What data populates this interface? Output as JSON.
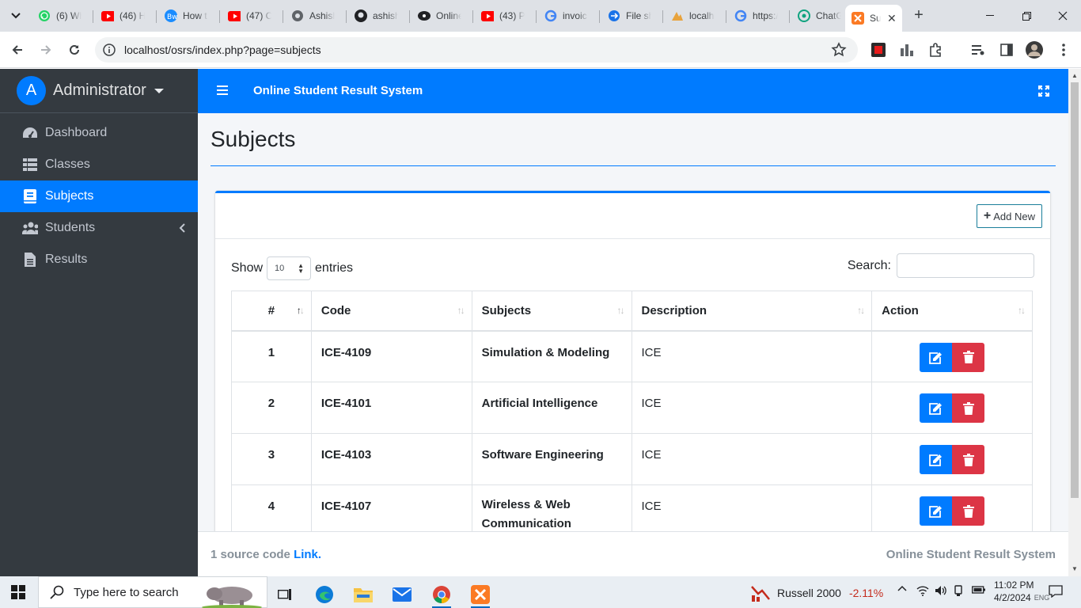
{
  "browser": {
    "tabs": [
      {
        "title": "(6) Wh",
        "icon": "whatsapp-icon"
      },
      {
        "title": "(46) H",
        "icon": "youtube-icon"
      },
      {
        "title": "How t",
        "icon": "blog-icon"
      },
      {
        "title": "(47) C",
        "icon": "youtube-icon"
      },
      {
        "title": "Ashish",
        "icon": "globe-icon"
      },
      {
        "title": "ashish",
        "icon": "github-icon"
      },
      {
        "title": "Online",
        "icon": "eye-icon"
      },
      {
        "title": "(43) P",
        "icon": "youtube-icon"
      },
      {
        "title": "invoic",
        "icon": "google-icon"
      },
      {
        "title": "File sh",
        "icon": "file-share-icon"
      },
      {
        "title": "localh",
        "icon": "phpmyadmin-icon"
      },
      {
        "title": "https:/",
        "icon": "google-icon"
      },
      {
        "title": "ChatG",
        "icon": "chatgpt-icon"
      },
      {
        "title": "Su",
        "icon": "xampp-icon",
        "active": true
      }
    ],
    "url": "localhost/osrs/index.php?page=subjects"
  },
  "sidebar": {
    "avatar_letter": "A",
    "user_name": "Administrator",
    "items": [
      {
        "label": "Dashboard",
        "icon": "dashboard-icon"
      },
      {
        "label": "Classes",
        "icon": "list-icon"
      },
      {
        "label": "Subjects",
        "icon": "book-icon",
        "active": true
      },
      {
        "label": "Students",
        "icon": "users-icon"
      },
      {
        "label": "Results",
        "icon": "file-icon"
      }
    ]
  },
  "header": {
    "app_title": "Online Student Result System"
  },
  "page": {
    "title": "Subjects",
    "add_new_label": "Add New",
    "show_label": "Show",
    "entries_value": "10",
    "entries_label": "entries",
    "search_label": "Search:",
    "search_value": ""
  },
  "table": {
    "columns": [
      "#",
      "Code",
      "Subjects",
      "Description",
      "Action"
    ],
    "rows": [
      {
        "num": "1",
        "code": "ICE-4109",
        "subject": "Simulation & Modeling",
        "description": "ICE"
      },
      {
        "num": "2",
        "code": "ICE-4101",
        "subject": "Artificial Intelligence",
        "description": "ICE"
      },
      {
        "num": "3",
        "code": "ICE-4103",
        "subject": "Software Engineering",
        "description": "ICE"
      },
      {
        "num": "4",
        "code": "ICE-4107",
        "subject": "Wireless & Web Communication",
        "description": "ICE"
      }
    ]
  },
  "footer": {
    "left_text": "1 source code",
    "link_text": "Link.",
    "right_text": "Online Student Result System"
  },
  "taskbar": {
    "search_placeholder": "Type here to search",
    "ticker_name": "Russell 2000",
    "ticker_change": "-2.11%",
    "time": "11:02 PM",
    "date": "4/2/2024",
    "lang": "ENG"
  },
  "colors": {
    "primary": "#007bff",
    "danger": "#dc3545",
    "sidebar_bg": "#343a40"
  }
}
